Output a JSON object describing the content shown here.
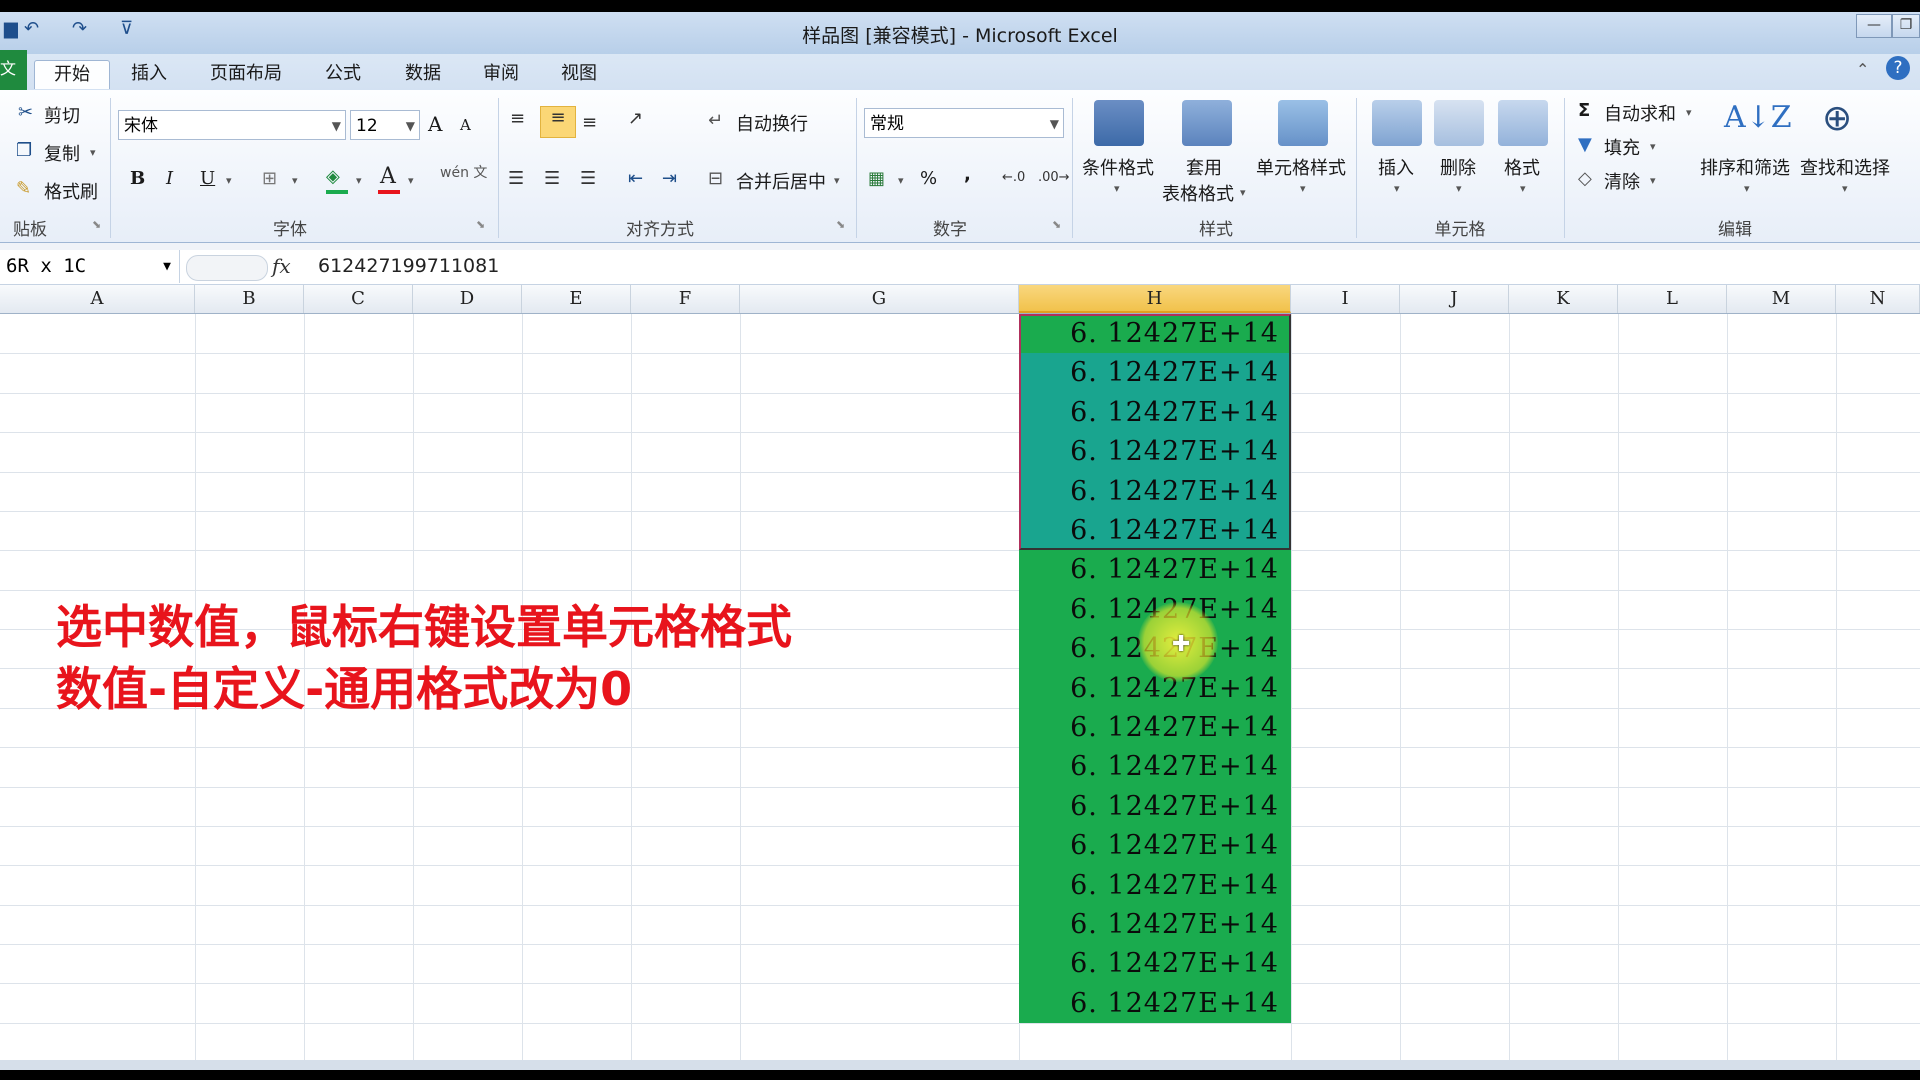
{
  "window": {
    "title": "样品图  [兼容模式]  -  Microsoft Excel",
    "min_label": "—",
    "max_label": "❐"
  },
  "quick_access": {
    "save": "▆",
    "undo": "↶",
    "redo": "↷",
    "more": "⊽"
  },
  "tabs": [
    {
      "label": "开始",
      "active": true
    },
    {
      "label": "插入"
    },
    {
      "label": "页面布局"
    },
    {
      "label": "公式"
    },
    {
      "label": "数据"
    },
    {
      "label": "审阅"
    },
    {
      "label": "视图"
    }
  ],
  "file_tab": "文",
  "ribbon": {
    "clipboard": {
      "cut": "剪切",
      "copy": "复制",
      "format_painter": "格式刷",
      "group": "贴板"
    },
    "font": {
      "name": "宋体",
      "size": "12",
      "bold": "B",
      "italic": "I",
      "underline": "U",
      "grow": "A",
      "shrink": "A",
      "phonetic": "wén 文",
      "group": "字体"
    },
    "align": {
      "wrap": "自动换行",
      "merge": "合并后居中",
      "group": "对齐方式"
    },
    "number": {
      "format": "常规",
      "percent": "%",
      "comma": ",",
      "group": "数字"
    },
    "styles": {
      "conditional": "条件格式",
      "table_line1": "套用",
      "table_line2": "表格格式",
      "cell_styles": "单元格样式",
      "group": "样式"
    },
    "cells": {
      "insert": "插入",
      "delete": "删除",
      "format": "格式",
      "group": "单元格"
    },
    "editing": {
      "autosum": "自动求和",
      "fill": "填充",
      "clear": "清除",
      "sort": "排序和筛选",
      "find": "查找和选择",
      "group": "编辑"
    }
  },
  "formula_bar": {
    "name_box": "6R x 1C",
    "fx": "fx",
    "value": "612427199711081"
  },
  "columns": [
    "A",
    "B",
    "C",
    "D",
    "E",
    "F",
    "G",
    "H",
    "I",
    "J",
    "K",
    "L",
    "M",
    "N"
  ],
  "selected_column": "H",
  "cells": [
    "6. 12427E+14",
    "6. 12427E+14",
    "6. 12427E+14",
    "6. 12427E+14",
    "6. 12427E+14",
    "6. 12427E+14",
    "6. 12427E+14",
    "6. 12427E+14",
    "6. 12427E+14",
    "6. 12427E+14",
    "6. 12427E+14",
    "6. 12427E+14",
    "6. 12427E+14",
    "6. 12427E+14",
    "6. 12427E+14",
    "6. 12427E+14",
    "6. 12427E+14",
    "6. 12427E+14"
  ],
  "caption": {
    "line1": "选中数值，鼠标右键设置单元格格式",
    "line2": "数值-自定义-通用格式改为0"
  },
  "colors": {
    "cell_green": "#1aab4e",
    "cell_selected": "#19a58f",
    "caption": "#e8141c",
    "column_header_selected": "#f1c24c"
  }
}
